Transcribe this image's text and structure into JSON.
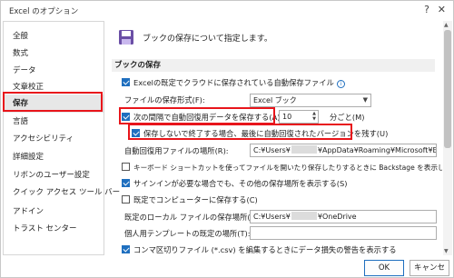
{
  "window": {
    "title": "Excel のオプション",
    "help_glyph": "?",
    "close_glyph": "✕"
  },
  "sidebar": {
    "items": [
      {
        "label": "全般"
      },
      {
        "label": "数式"
      },
      {
        "label": "データ"
      },
      {
        "label": "文章校正"
      },
      {
        "label": "保存",
        "active": true
      },
      {
        "label": "言語"
      },
      {
        "label": "アクセシビリティ"
      },
      {
        "label": "詳細設定"
      },
      {
        "label": "リボンのユーザー設定"
      },
      {
        "label": "クイック アクセス ツール バー"
      },
      {
        "label": "アドイン"
      },
      {
        "label": "トラスト センター"
      }
    ]
  },
  "content": {
    "header": "ブックの保存について指定します。",
    "section_title": "ブックの保存",
    "cloud_autosave": {
      "label": "Excelの既定でクラウドに保存されている自動保存ファイル",
      "checked": true
    },
    "format_label": "ファイルの保存形式(F):",
    "format_value": "Excel ブック",
    "autorecover": {
      "label": "次の間隔で自動回復用データを保存する(A):",
      "checked": true,
      "value": "10",
      "unit": "分ごと(M)"
    },
    "keep_last": {
      "label": "保存しないで終了する場合、最後に自動回復されたバージョンを残す(U)",
      "checked": true
    },
    "autorecover_location": {
      "label": "自動回復用ファイルの場所(R):",
      "prefix": "C:¥Users¥",
      "suffix": "¥AppData¥Roaming¥Microsoft¥E"
    },
    "backstage": {
      "label": "キーボード ショートカットを使ってファイルを開いたり保存したりするときに Backstage を表示しない(S)",
      "checked": false
    },
    "signin": {
      "label": "サインインが必要な場合でも、その他の保存場所を表示する(S)",
      "checked": true
    },
    "save_local": {
      "label": "既定でコンピューターに保存する(C)",
      "checked": false
    },
    "local_location": {
      "label": "既定のローカル ファイルの保存場所(I):",
      "prefix": "C:¥Users¥",
      "suffix": "¥OneDrive"
    },
    "template_location": {
      "label": "個人用テンプレートの既定の場所(T):",
      "value": ""
    },
    "csv_warning": {
      "label": "コンマ区切りファイル (*.csv) を編集するときにデータ損失の警告を表示する",
      "checked": true
    }
  },
  "footer": {
    "ok": "OK",
    "cancel": "キャンセル"
  },
  "colors": {
    "highlight": "#e8151b",
    "accent": "#1f6fbf",
    "active_bg": "#e7e7e7"
  },
  "icons": [
    "save-icon",
    "info-icon",
    "help-icon",
    "close-icon",
    "checkbox-icon",
    "dropdown-arrow-icon",
    "spinner-icon"
  ]
}
